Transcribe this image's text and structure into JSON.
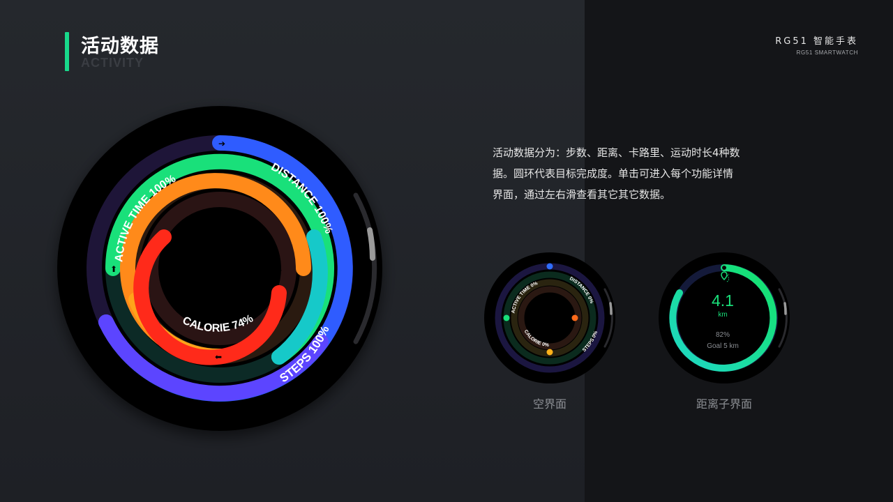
{
  "header": {
    "title_cn": "活动数据",
    "title_en": "ACTIVITY",
    "brand_main": "RG51 智能手表",
    "brand_sub": "RG51 SMARTWATCH"
  },
  "description": {
    "lines": [
      "活动数据分为：步数、距离、卡路里、运动时长4种数",
      "据。圆环代表目标完成度。单击可进入每个功能详情",
      "界面，通过左右滑查看其它其它数据。"
    ]
  },
  "main_watch": {
    "rings": [
      {
        "label": "STEPS 100%",
        "color": "#6a3cff",
        "progress": 1.0
      },
      {
        "label": "DISTANCE 100%",
        "color": "#19e07a",
        "progress": 1.0
      },
      {
        "label": "ACTIVE TIME 100%",
        "color": "#ffb21a",
        "progress": 1.0
      },
      {
        "label": "CALORIE 74%",
        "color": "#ff2a1a",
        "progress": 0.74
      }
    ]
  },
  "empty_watch": {
    "labels": [
      "ACTIVE TIME 0%",
      "DISTANCE 0%",
      "CALORIE 0%",
      "STEPS 0%"
    ],
    "caption": "空界面"
  },
  "distance_watch": {
    "value": "4.1",
    "unit": "km",
    "percent": "82%",
    "goal": "Goal 5 km",
    "progress": 0.82,
    "caption": "距离子界面",
    "colors": {
      "start": "#1fd7c6",
      "end": "#14e36a"
    }
  }
}
